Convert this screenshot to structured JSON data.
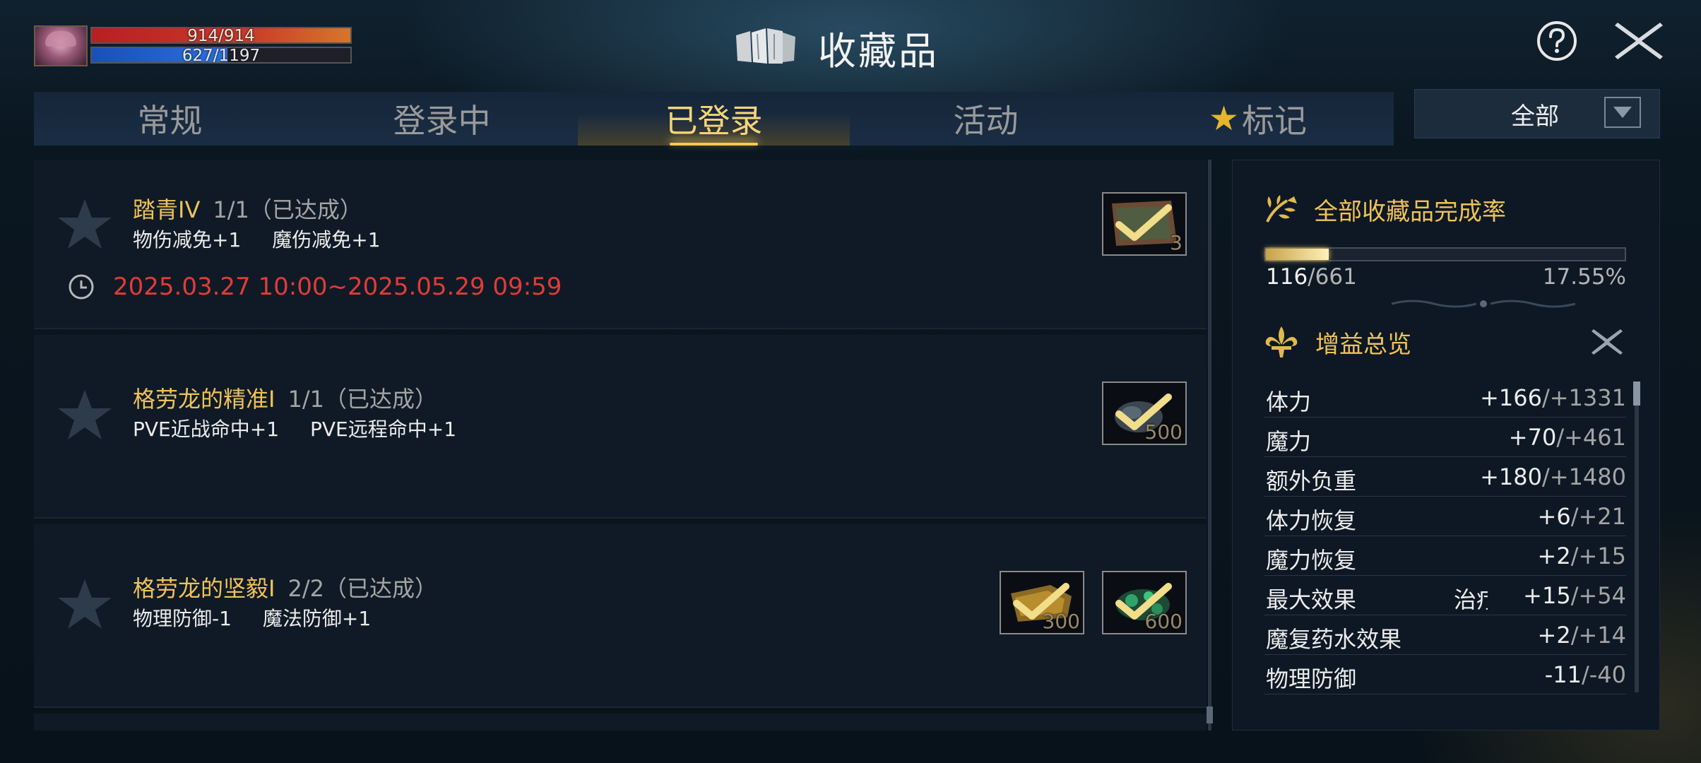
{
  "player": {
    "hp": "914/914",
    "mp": "627/1197",
    "mp_ratio": 0.524
  },
  "header": {
    "title": "收藏品"
  },
  "tabs": [
    {
      "label": "常规",
      "active": false
    },
    {
      "label": "登录中",
      "active": false
    },
    {
      "label": "已登录",
      "active": true
    },
    {
      "label": "活动",
      "active": false
    },
    {
      "label": "标记",
      "active": false,
      "icon": "star-icon"
    }
  ],
  "filter": {
    "label": "全部"
  },
  "collections": [
    {
      "name": "踏青IV",
      "progress": "1/1（已达成）",
      "stats": [
        "物伤减免+1",
        "魔伤减免+1"
      ],
      "period": "2025.03.27 10:00~2025.05.29 09:59",
      "items": [
        {
          "icon": "map-icon",
          "count": "3"
        }
      ]
    },
    {
      "name": "格劳龙的精准I",
      "progress": "1/1（已达成）",
      "stats": [
        "PVE近战命中+1",
        "PVE远程命中+1"
      ],
      "items": [
        {
          "icon": "ore-icon",
          "count": "500"
        }
      ]
    },
    {
      "name": "格劳龙的坚毅I",
      "progress": "2/2（已达成）",
      "stats": [
        "物理防御-1",
        "魔法防御+1"
      ],
      "items": [
        {
          "icon": "gold-ore-icon",
          "count": "300"
        },
        {
          "icon": "emerald-ore-icon",
          "count": "600"
        }
      ]
    }
  ],
  "completion": {
    "title": "全部收藏品完成率",
    "count": "116",
    "total": "/661",
    "percent": "17.55%",
    "ratio": 0.1755
  },
  "buffs": {
    "title": "增益总览",
    "items": [
      {
        "name": "体力",
        "value": "+166",
        "total": "/+1331"
      },
      {
        "name": "魔力",
        "value": "+70",
        "total": "/+461"
      },
      {
        "name": "额外负重",
        "value": "+180",
        "total": "/+1480"
      },
      {
        "name": "体力恢复",
        "value": "+6",
        "total": "/+21"
      },
      {
        "name": "魔力恢复",
        "value": "+2",
        "total": "/+15"
      },
      {
        "name": "最大效果",
        "value": "+15",
        "total": "/+54",
        "overlap": "治疗"
      },
      {
        "name": "魔复药水效果",
        "value": "+2",
        "total": "/+14"
      },
      {
        "name": "物理防御",
        "value": "-11",
        "total": "/-40"
      }
    ]
  },
  "colors": {
    "gold": "#f0c25a",
    "red_date": "#e03c37",
    "hp": "#c93a28",
    "mp": "#2f6ee0"
  }
}
